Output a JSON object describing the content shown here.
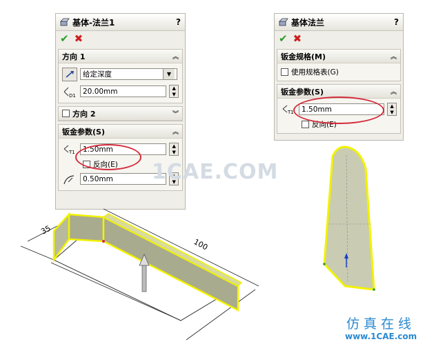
{
  "left_panel": {
    "title": "基体-法兰1",
    "help": "?",
    "groups": {
      "direction1": {
        "label": "方向 1",
        "end_condition": "给定深度",
        "depth_symbol": "D1",
        "depth": "20.00mm"
      },
      "direction2": {
        "label": "方向 2"
      },
      "sheet_metal": {
        "label": "钣金参数(S)",
        "thickness_symbol": "T1",
        "thickness": "1.50mm",
        "reverse_label": "反向(E)",
        "radius": "0.50mm"
      }
    }
  },
  "right_panel": {
    "title": "基体法兰",
    "help": "?",
    "groups": {
      "gauge": {
        "label": "钣金规格(M)",
        "use_table_label": "使用规格表(G)"
      },
      "sheet_metal": {
        "label": "钣金参数(S)",
        "thickness_symbol": "T1",
        "thickness": "1.50mm",
        "reverse_label": "反向(E)"
      }
    }
  },
  "model": {
    "dim_35": "35",
    "dim_100": "100"
  },
  "watermark": {
    "center": "1CAE.COM",
    "cn": "仿真在线",
    "url": "www.1CAE.com"
  },
  "colors": {
    "ok": "#2a9a2a",
    "cancel": "#cc1f1f",
    "highlight": "#d42b3a",
    "edge": "#f2f200",
    "wall": "#a9ab8e"
  }
}
